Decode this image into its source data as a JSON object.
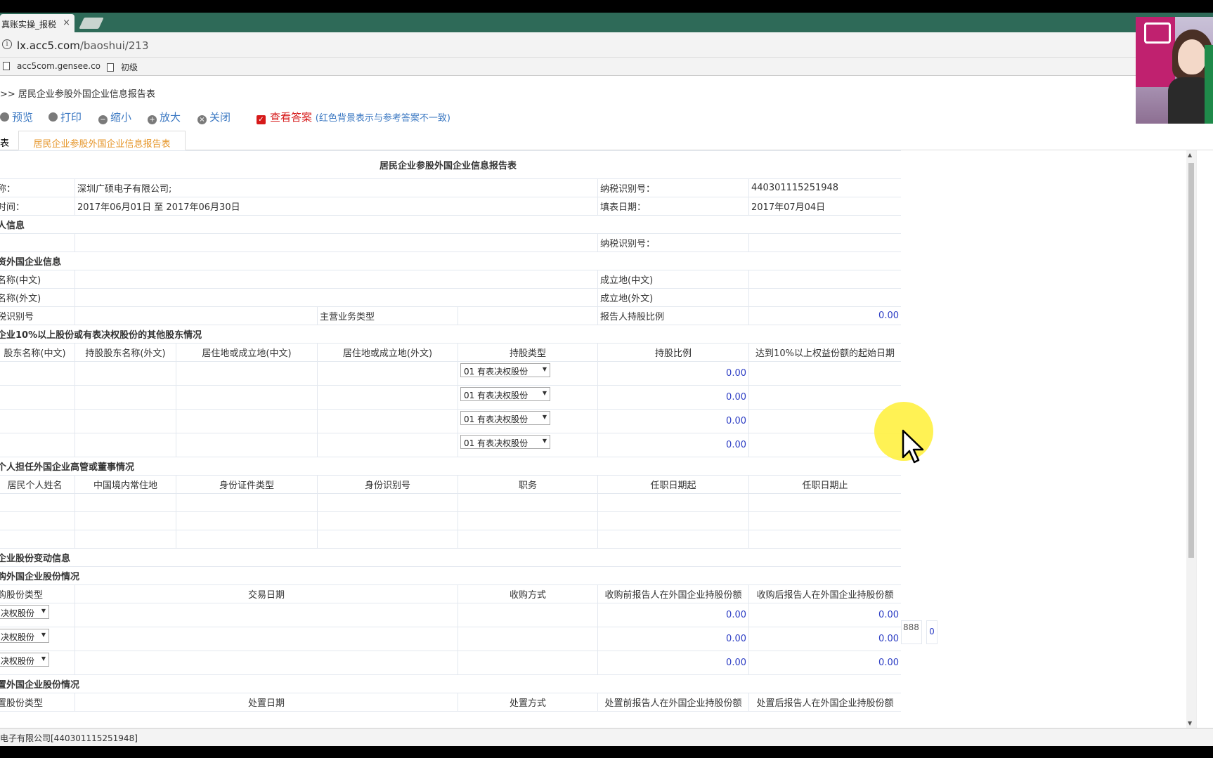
{
  "browser": {
    "tab_title": "真账实操_报税",
    "tab_close": "×",
    "url_host": "lx.acc5.com",
    "url_path": "/baoshui/213",
    "bookmarks": [
      "acc5com.gensee.co",
      "初级"
    ]
  },
  "breadcrumb": ">> 居民企业参股外国企业信息报告表",
  "toolbar": {
    "preview": "预览",
    "print": "打印",
    "zoom_out": "缩小",
    "zoom_in": "放大",
    "close": "关闭",
    "check_answer": "查看答案",
    "check_answer_note": "(红色背景表示与参考答案不一致)"
  },
  "tabs": {
    "left_partial": "表",
    "active": "居民企业参股外国企业信息报告表"
  },
  "form": {
    "title": "居民企业参股外国企业信息报告表",
    "name_label": "称：",
    "name_value": "深圳广硕电子有限公司;",
    "tax_id_label": "纳税识别号：",
    "tax_id_value": "440301115251948",
    "period_label": "时间：",
    "period_value": "2017年06月01日 至 2017年06月30日",
    "fill_date_label": "填表日期：",
    "fill_date_value": "2017年07月04日",
    "section_person": "人信息",
    "person_colon": ":",
    "person_tax_id_label": "纳税识别号：",
    "section_foreign": "资外国企业信息",
    "name_cn_label": "名称(中文)",
    "est_cn_label": "成立地(中文)",
    "name_en_label": "名称(外文)",
    "est_en_label": "成立地(外文)",
    "tax_no_label": "税识别号",
    "business_type_label": "主营业务类型",
    "holding_ratio_label": "报告人持股比例",
    "holding_ratio_value": "0.00",
    "section_shareholders": "企业10%以上股份或有表决权股份的其他股东情况",
    "shareholder_headers": [
      "股东名称(中文)",
      "持股股东名称(外文)",
      "居住地或成立地(中文)",
      "居住地或成立地(外文)",
      "持股类型",
      "持股比例",
      "达到10%以上权益份额的起始日期"
    ],
    "shareholder_rows": [
      {
        "type": "01 有表决权股份",
        "ratio": "0.00"
      },
      {
        "type": "01 有表决权股份",
        "ratio": "0.00"
      },
      {
        "type": "01 有表决权股份",
        "ratio": "0.00"
      },
      {
        "type": "01 有表决权股份",
        "ratio": "0.00"
      }
    ],
    "section_directors": "个人担任外国企业高管或董事情况",
    "director_headers": [
      "居民个人姓名",
      "中国境内常住地",
      "身份证件类型",
      "身份识别号",
      "职务",
      "任职日期起",
      "任职日期止"
    ],
    "section_changes": "企业股份变动信息",
    "section_acquire": "购外国企业股份情况",
    "acquire_headers": [
      "购股份类型",
      "交易日期",
      "收购方式",
      "收购前报告人在外国企业持股份额",
      "收购后报告人在外国企业持股份额"
    ],
    "acquire_rows": [
      {
        "type": "决权股份",
        "before": "0.00",
        "after": "0.00"
      },
      {
        "type": "决权股份",
        "before": "0.00",
        "after": "0.00"
      },
      {
        "type": "决权股份",
        "before": "0.00",
        "after": "0.00"
      }
    ],
    "extra_left": "888",
    "extra_right": "0",
    "section_dispose": "置外国企业股份情况",
    "dispose_headers_partial": [
      "置股份类型",
      "处置日期",
      "处置方式",
      "处置前报告人在外国企业持股份额",
      "处置后报告人在外国企业持股份额"
    ]
  },
  "status_bar": "电子有限公司[440301115251948]"
}
